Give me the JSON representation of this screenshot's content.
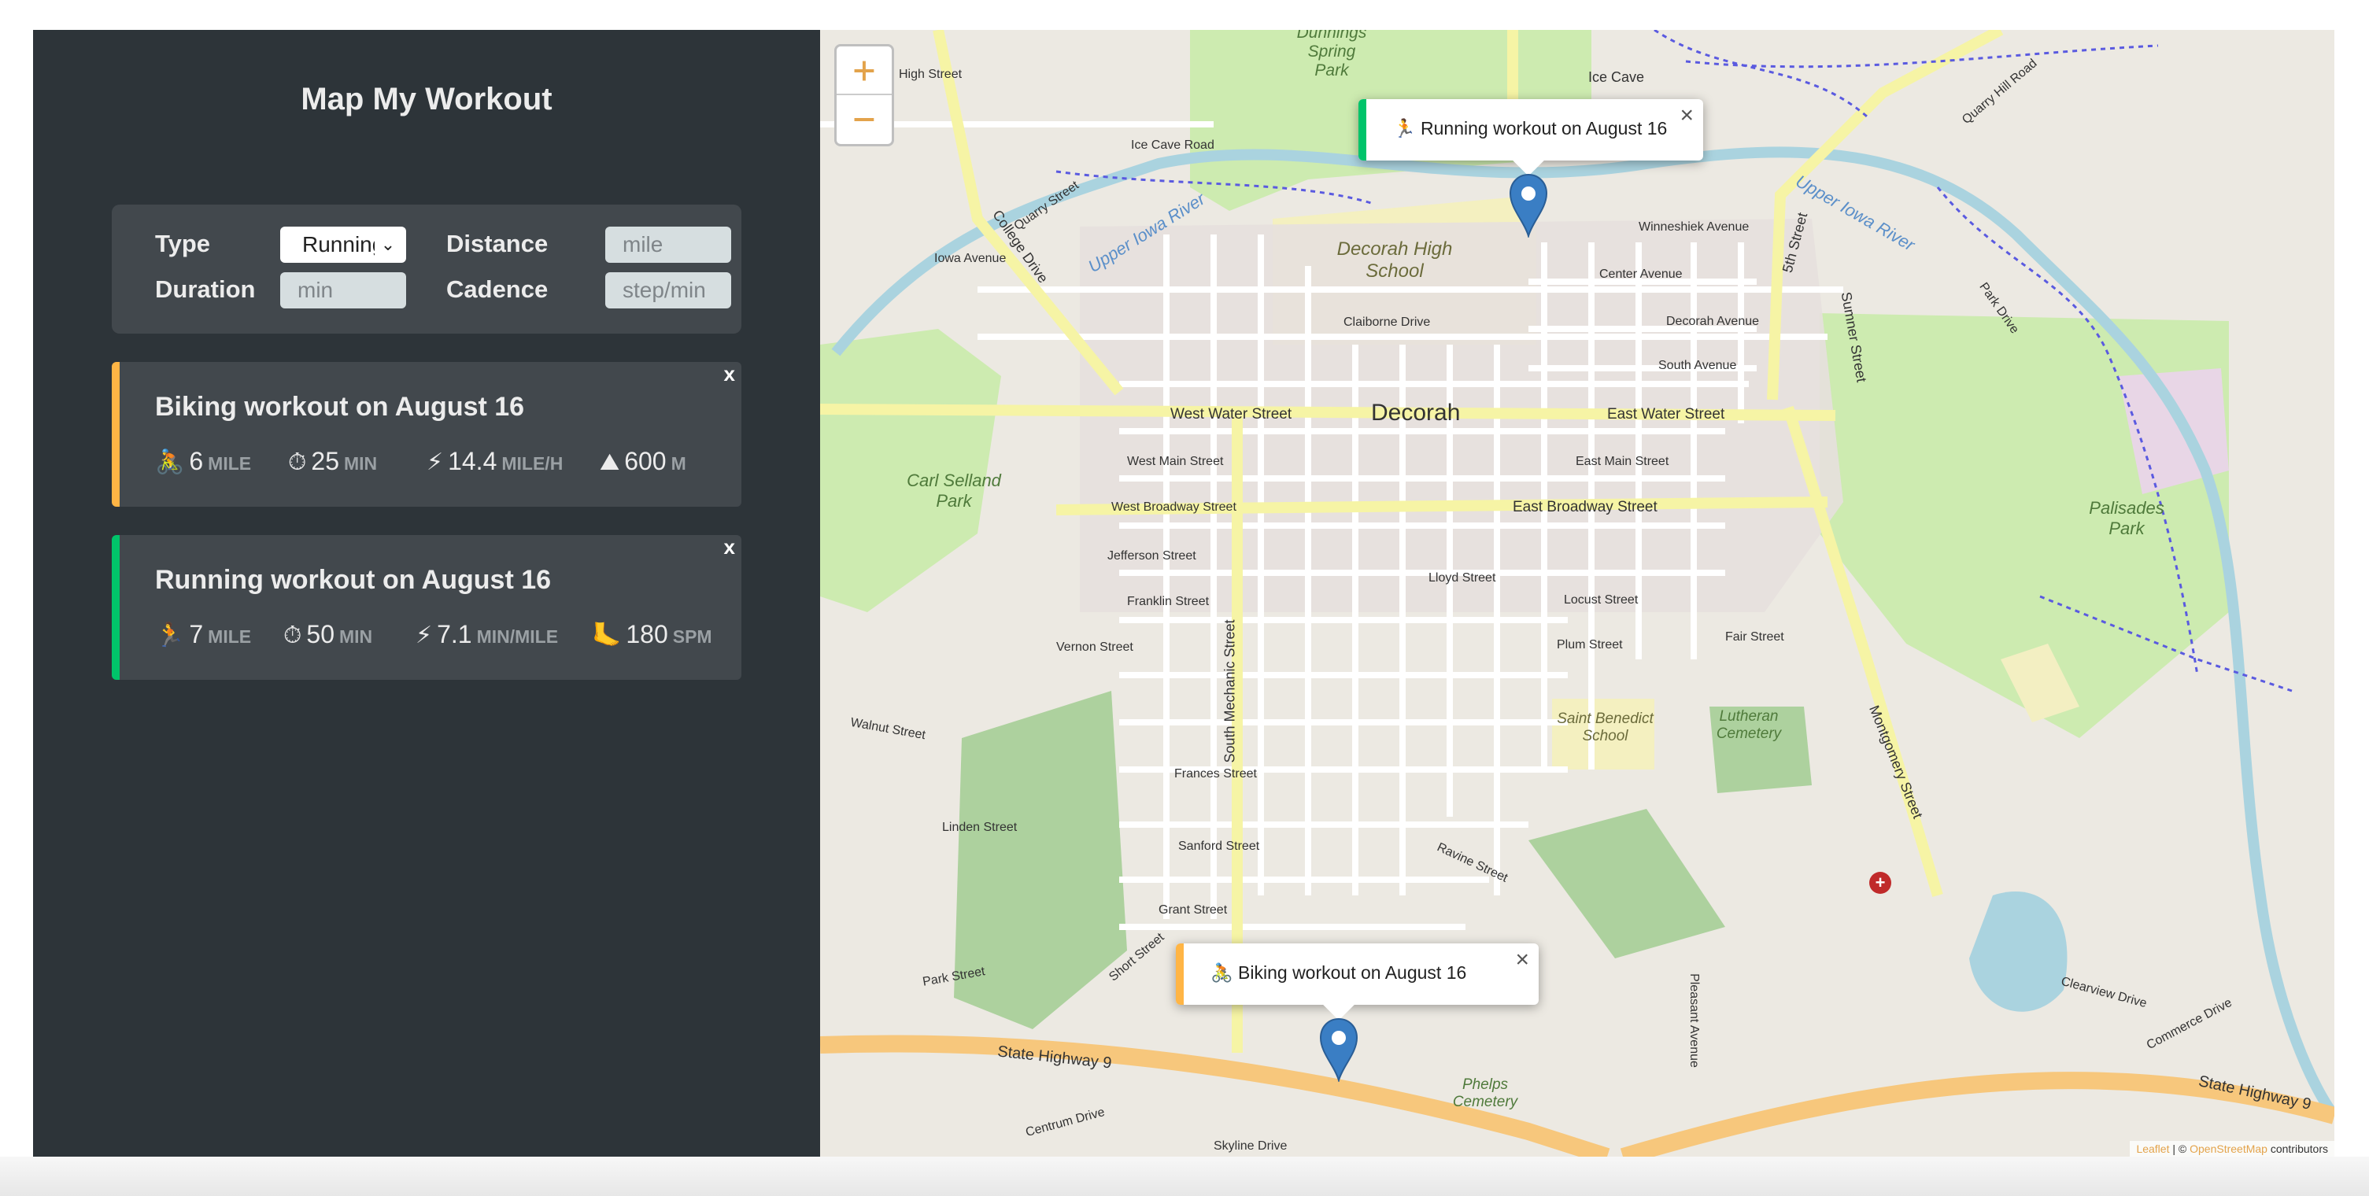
{
  "app": {
    "title": "Map My Workout"
  },
  "form": {
    "type_label": "Type",
    "type_value": "Running",
    "distance_label": "Distance",
    "distance_placeholder": "mile",
    "duration_label": "Duration",
    "duration_placeholder": "min",
    "cadence_label": "Cadence",
    "cadence_placeholder": "step/min"
  },
  "workouts": [
    {
      "type": "cycling",
      "title": "Biking workout on August 16",
      "color": "#ffb545",
      "delete_label": "x",
      "icon": "biker-icon",
      "stats": [
        {
          "icon": "🚴",
          "value": "6",
          "unit": "MILE"
        },
        {
          "icon": "⏱",
          "value": "25",
          "unit": "MIN"
        },
        {
          "icon": "⚡",
          "value": "14.4",
          "unit": "MILE/H"
        },
        {
          "icon": "⛰",
          "value": "600",
          "unit": "M"
        }
      ]
    },
    {
      "type": "running",
      "title": "Running workout on August 16",
      "color": "#00c46a",
      "delete_label": "x",
      "icon": "runner-icon",
      "stats": [
        {
          "icon": "🏃",
          "value": "7",
          "unit": "MILE"
        },
        {
          "icon": "⏱",
          "value": "50",
          "unit": "MIN"
        },
        {
          "icon": "⚡",
          "value": "7.1",
          "unit": "MIN/MILE"
        },
        {
          "icon": "🦶",
          "value": "180",
          "unit": "SPM"
        }
      ]
    }
  ],
  "map": {
    "zoom_in": "+",
    "zoom_out": "−",
    "popups": [
      {
        "icon": "🏃",
        "text": "Running workout on August 16",
        "close": "×",
        "color": "#00c46a"
      },
      {
        "icon": "🚴",
        "text": "Biking workout on August 16",
        "close": "×",
        "color": "#ffb545"
      }
    ],
    "attribution": {
      "leaflet": "Leaflet",
      "sep": " | © ",
      "osm": "OpenStreetMap",
      "suffix": " contributors"
    },
    "labels": {
      "decorah": "Decorah",
      "decorah_high_school": "Decorah High School",
      "west_water_street": "West Water Street",
      "east_water_street": "East Water Street",
      "east_broadway_street": "East Broadway Street",
      "west_broadway_street": "West Broadway Street",
      "west_main_street": "West Main Street",
      "east_main_street": "East Main Street",
      "state_highway_9": "State Highway 9",
      "montgomery_street": "Montgomery Street",
      "south_mechanic_street": "South Mechanic Street",
      "carl_selland_park": "Carl Selland Park",
      "palisades_park": "Palisades Park",
      "saint_benedict_school": "Saint Benedict School",
      "lutheran_cemetery": "Lutheran Cemetery",
      "phelps_cemetery": "Phelps Cemetery",
      "upper_iowa_river": "Upper Iowa River",
      "college_drive": "College Drive",
      "ice_cave_road": "Ice Cave Road",
      "ice_cave": "Ice Cave",
      "quarry_hill_road": "Quarry Hill Road",
      "dunnings_spring_park": "Dunnings Spring Park",
      "winneshiek_avenue": "Winneshiek Avenue",
      "center_avenue": "Center Avenue",
      "decorah_avenue": "Decorah Avenue",
      "south_avenue": "South Avenue",
      "claiborne_drive": "Claiborne Drive",
      "sumner_street": "Sumner Street",
      "jefferson_street": "Jefferson Street",
      "franklin_street": "Franklin Street",
      "vernon_street": "Vernon Street",
      "lloyd_street": "Lloyd Street",
      "locust_street": "Locust Street",
      "plum_street": "Plum Street",
      "fair_street": "Fair Street",
      "frances_street": "Frances Street",
      "sanford_street": "Sanford Street",
      "grant_street": "Grant Street",
      "ravine_street": "Ravine Street",
      "walnut_street": "Walnut Street",
      "linden_street": "Linden Street",
      "park_street": "Park Street",
      "short_street": "Short Street",
      "commerce_drive": "Commerce Drive",
      "clearview_drive": "Clearview Drive",
      "centrum_drive": "Centrum Drive",
      "skyline_drive": "Skyline Drive",
      "high_street": "High Street",
      "quarry_street": "Quarry Street",
      "iowa_avenue": "Iowa Avenue",
      "fifth_street": "5th Street",
      "pleasant_avenue": "Pleasant Avenue",
      "park_drive": "Park Drive"
    }
  }
}
